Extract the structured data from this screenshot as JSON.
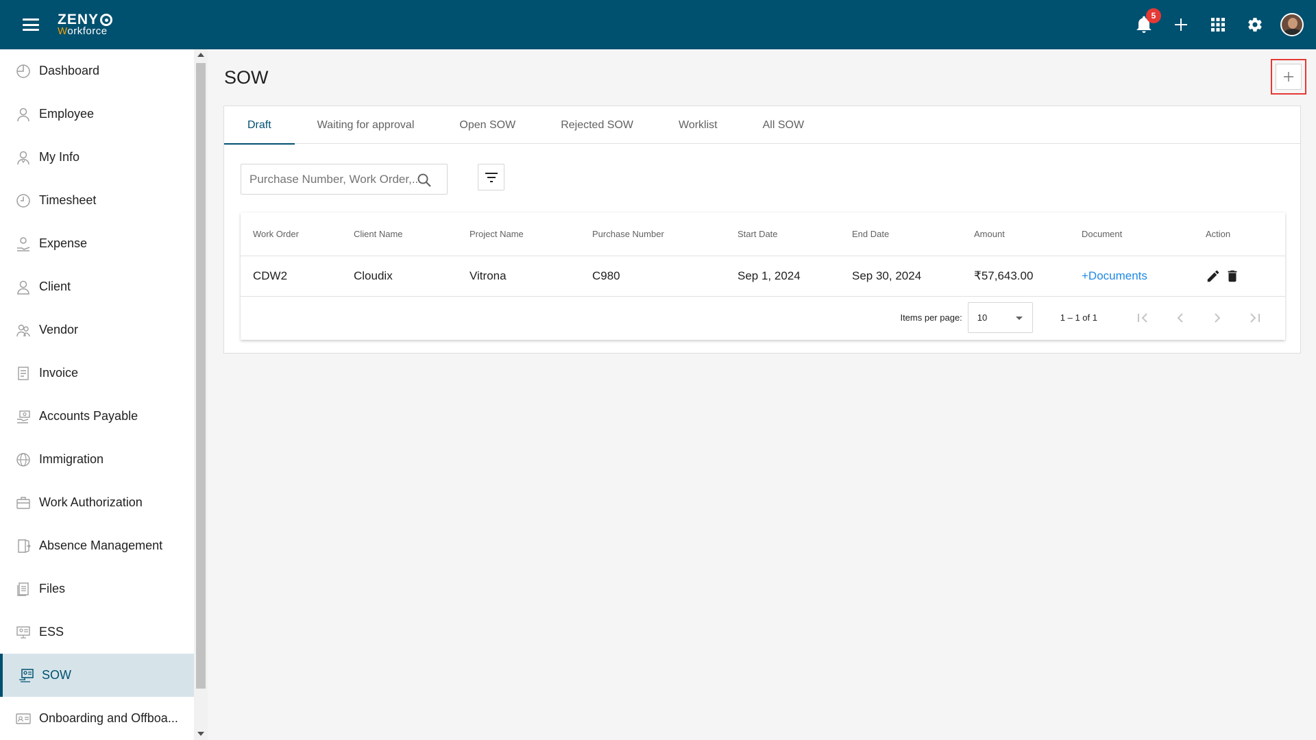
{
  "app": {
    "logo_top": "ZENY",
    "logo_bottom_accent": "W",
    "logo_bottom_rest": "orkforce",
    "notification_count": "5"
  },
  "sidebar": {
    "items": [
      {
        "label": "Dashboard",
        "icon": "dashboard-icon"
      },
      {
        "label": "Employee",
        "icon": "employee-icon"
      },
      {
        "label": "My Info",
        "icon": "my-info-icon"
      },
      {
        "label": "Timesheet",
        "icon": "clock-icon"
      },
      {
        "label": "Expense",
        "icon": "expense-icon"
      },
      {
        "label": "Client",
        "icon": "client-icon"
      },
      {
        "label": "Vendor",
        "icon": "vendor-icon"
      },
      {
        "label": "Invoice",
        "icon": "invoice-icon"
      },
      {
        "label": "Accounts Payable",
        "icon": "accounts-payable-icon"
      },
      {
        "label": "Immigration",
        "icon": "globe-icon"
      },
      {
        "label": "Work Authorization",
        "icon": "briefcase-icon"
      },
      {
        "label": "Absence Management",
        "icon": "door-icon"
      },
      {
        "label": "Files",
        "icon": "files-icon"
      },
      {
        "label": "ESS",
        "icon": "ess-icon"
      },
      {
        "label": "SOW",
        "icon": "sow-icon"
      },
      {
        "label": "Onboarding and Offboa...",
        "icon": "id-card-icon"
      }
    ],
    "active": "SOW"
  },
  "main": {
    "title": "SOW",
    "add_button": "+",
    "tabs": [
      {
        "label": "Draft",
        "active": true
      },
      {
        "label": "Waiting for approval",
        "active": false
      },
      {
        "label": "Open SOW",
        "active": false
      },
      {
        "label": "Rejected SOW",
        "active": false
      },
      {
        "label": "Worklist",
        "active": false
      },
      {
        "label": "All SOW",
        "active": false
      }
    ],
    "search": {
      "placeholder": "Purchase Number, Work Order,...",
      "value": ""
    }
  },
  "table": {
    "columns": [
      "Work Order",
      "Client Name",
      "Project Name",
      "Purchase Number",
      "Start Date",
      "End Date",
      "Amount",
      "Document",
      "Action"
    ],
    "rows": [
      {
        "work_order": "CDW2",
        "client_name": "Cloudix",
        "project_name": "Vitrona",
        "purchase_number": "C980",
        "start_date": "Sep 1, 2024",
        "end_date": "Sep 30, 2024",
        "amount": "₹57,643.00",
        "document": "+Documents"
      }
    ]
  },
  "paginator": {
    "items_per_page_label": "Items per page:",
    "items_per_page": "10",
    "range": "1 – 1 of 1"
  },
  "colors": {
    "header": "#00506f",
    "accent_link": "#1e88e5",
    "badge": "#e53935",
    "highlight": "#e53935"
  }
}
